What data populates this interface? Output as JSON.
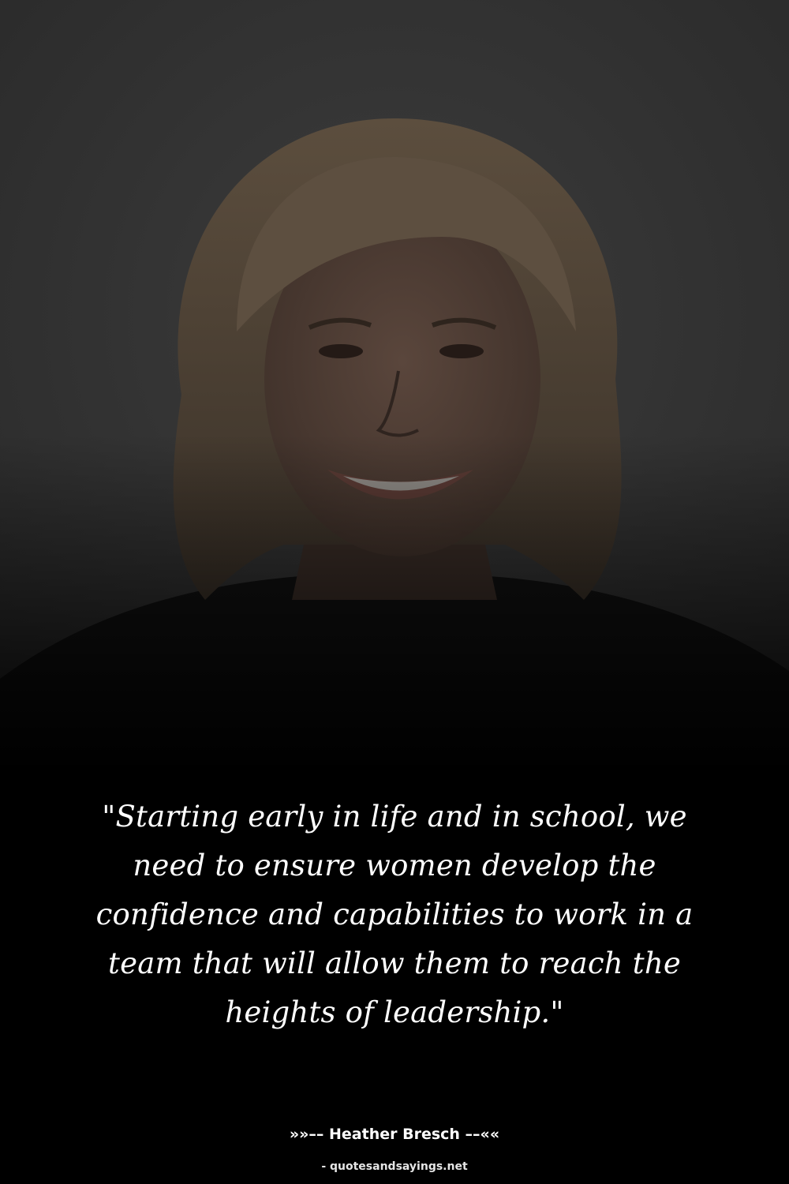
{
  "quote": {
    "text": "\"Starting early in life and in school, we need to ensure women develop the confidence and capabilities to work in a team that will allow them to reach the heights of leadership.\""
  },
  "attribution": {
    "author_line": "»»–– Heather Bresch ––««",
    "source": "- quotesandsayings.net"
  },
  "colors": {
    "background": "#000000",
    "text": "#ffffff",
    "photo_tint": "#3a3a3a"
  }
}
